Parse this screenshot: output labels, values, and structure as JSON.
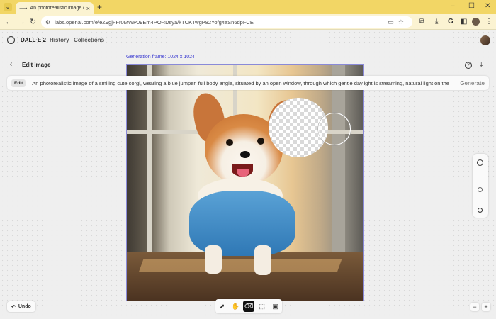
{
  "browser": {
    "tab_title": "An photorealistic image of a smiling cute corgi",
    "url": "labs.openai.com/e/eZ9gjFFr0MWP09Em4PORDsya/kTCKTwgP82Yofg4aSn6dpFCE",
    "new_tab": "+",
    "window_controls": [
      "–",
      "☐",
      "✕"
    ]
  },
  "app": {
    "brand": "DALL·E 2",
    "nav": [
      "History",
      "Collections"
    ]
  },
  "editor": {
    "frame_label": "Generation frame: 1024 x 1024",
    "title": "Edit image",
    "prompt_chip": "Edit",
    "prompt": "An photorealistic image of a smiling cute corgi, wearing a blue jumper, full body angle, situated by an open window, through which gentle daylight is streaming, natural light on the",
    "generate_label": "Generate",
    "undo_label": "Undo",
    "brush_size_level": 0.45
  },
  "icons": {
    "help": "?",
    "back": "‹",
    "download": "⤓",
    "more": "···",
    "zoom_out": "−",
    "zoom_in": "+"
  },
  "tools": [
    {
      "name": "select-tool-icon",
      "glyph": "⬈"
    },
    {
      "name": "hand-tool-icon",
      "glyph": "✋"
    },
    {
      "name": "eraser-tool-icon",
      "glyph": "⌫"
    },
    {
      "name": "frame-tool-icon",
      "glyph": "⬚"
    },
    {
      "name": "upload-image-icon",
      "glyph": "▣"
    }
  ],
  "colors": {
    "tab_bar": "#f2d665",
    "frame_label": "#3b3bd0",
    "active_tool": "#111111"
  }
}
